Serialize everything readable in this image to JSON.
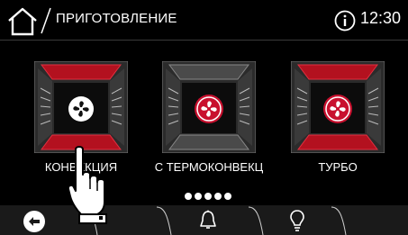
{
  "header": {
    "title": "ПРИГОТОВЛЕНИЕ",
    "time": "12:30"
  },
  "modes": [
    {
      "label": "КОНВЕКЦИЯ",
      "icon": "fan-icon",
      "accent": "#c8102e"
    },
    {
      "label": "С ТЕРМОКОНВЕКЦ",
      "icon": "fan-icon",
      "accent": "#c8102e"
    },
    {
      "label": "ТУРБО",
      "icon": "fan-icon",
      "accent": "#c8102e"
    }
  ],
  "pagination": {
    "pages": 5
  },
  "footer": {
    "icons": [
      "back-icon",
      "bell-icon",
      "lightbulb-icon"
    ]
  },
  "colors": {
    "accent": "#c8102e",
    "background": "#000000",
    "footer": "#1a1a1a"
  }
}
